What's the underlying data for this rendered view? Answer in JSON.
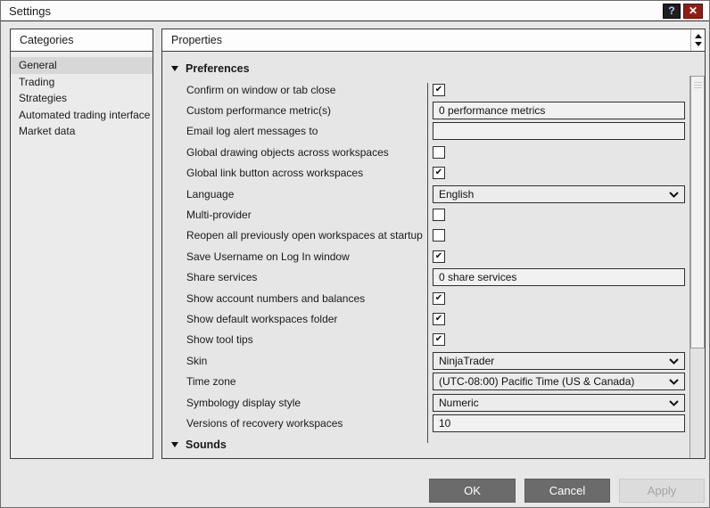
{
  "window": {
    "title": "Settings",
    "help_label": "?",
    "close_label": "✕"
  },
  "icons": {
    "check": "✔"
  },
  "categories": {
    "header": "Categories",
    "items": [
      {
        "label": "General",
        "selected": true
      },
      {
        "label": "Trading",
        "selected": false
      },
      {
        "label": "Strategies",
        "selected": false
      },
      {
        "label": "Automated trading interface",
        "selected": false
      },
      {
        "label": "Market data",
        "selected": false
      }
    ]
  },
  "properties": {
    "header": "Properties",
    "sections": [
      {
        "label": "Preferences",
        "expanded": true,
        "rows": [
          {
            "label": "Confirm on window or tab close",
            "control": "checkbox",
            "checked": true
          },
          {
            "label": "Custom performance metric(s)",
            "control": "text",
            "value": "0 performance metrics"
          },
          {
            "label": "Email log alert messages to",
            "control": "text",
            "value": ""
          },
          {
            "label": "Global drawing objects across workspaces",
            "control": "checkbox",
            "checked": false
          },
          {
            "label": "Global link button across workspaces",
            "control": "checkbox",
            "checked": true
          },
          {
            "label": "Language",
            "control": "select",
            "value": "English"
          },
          {
            "label": "Multi-provider",
            "control": "checkbox",
            "checked": false
          },
          {
            "label": "Reopen all previously open workspaces at startup",
            "control": "checkbox",
            "checked": false
          },
          {
            "label": "Save Username on Log In window",
            "control": "checkbox",
            "checked": true
          },
          {
            "label": "Share services",
            "control": "text",
            "value": "0 share services"
          },
          {
            "label": "Show account numbers and balances",
            "control": "checkbox",
            "checked": true
          },
          {
            "label": "Show default workspaces folder",
            "control": "checkbox",
            "checked": true
          },
          {
            "label": "Show tool tips",
            "control": "checkbox",
            "checked": true
          },
          {
            "label": "Skin",
            "control": "select",
            "value": "NinjaTrader"
          },
          {
            "label": "Time zone",
            "control": "select",
            "value": "(UTC-08:00) Pacific Time (US & Canada)"
          },
          {
            "label": "Symbology display style",
            "control": "select",
            "value": "Numeric"
          },
          {
            "label": "Versions of recovery workspaces",
            "control": "text",
            "value": "10"
          }
        ]
      },
      {
        "label": "Sounds",
        "expanded": true,
        "rows": []
      }
    ]
  },
  "footer": {
    "ok_label": "OK",
    "cancel_label": "Cancel",
    "apply_label": "Apply",
    "apply_enabled": false
  },
  "colors": {
    "dark_button": "#6b6b6b",
    "close_button_red": "#8f1d15",
    "panel_border": "#3c3c3c",
    "selected_item": "#d7d7d7"
  }
}
